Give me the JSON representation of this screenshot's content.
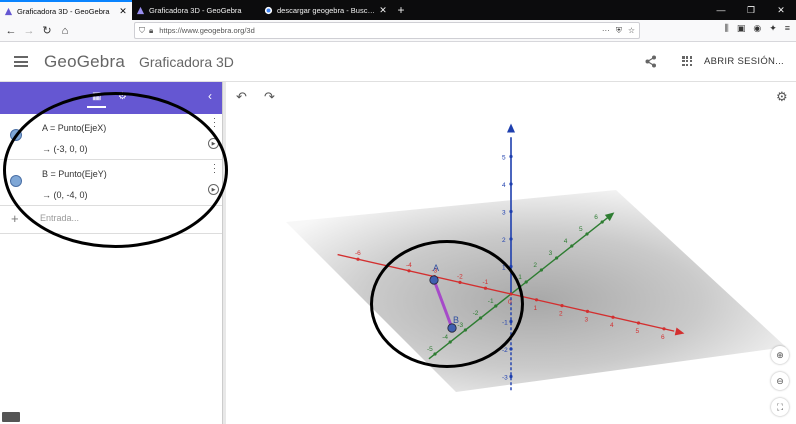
{
  "browser": {
    "tabs": [
      {
        "title": "Graficadora 3D - GeoGebra",
        "active": true
      },
      {
        "title": "Graficadora 3D - GeoGebra",
        "active": false
      },
      {
        "title": "descargar geogebra - Buscar c",
        "active": false
      }
    ],
    "url": "https://www.geogebra.org/3d"
  },
  "header": {
    "logo": "GeoGebra",
    "app_title": "Graficadora 3D",
    "signin_label": "ABRIR SESIÓN..."
  },
  "algebra": {
    "items": [
      {
        "definition": "A = Punto(EjeX)",
        "value": "→  (-3, 0, 0)",
        "color": "#7fa7d6"
      },
      {
        "definition": "B = Punto(EjeY)",
        "value": "→  (0, -4, 0)",
        "color": "#7fa7d6"
      }
    ],
    "input_placeholder": "Entrada..."
  },
  "graphics": {
    "x_axis_ticks": [
      "-6",
      "-4",
      "-3",
      "-2",
      "-1",
      "0",
      "1",
      "2",
      "3",
      "4",
      "5",
      "6"
    ],
    "y_axis_ticks": [
      "-5",
      "-4",
      "-3",
      "-2",
      "-1",
      "1",
      "2",
      "3",
      "4",
      "5",
      "6"
    ],
    "z_axis_ticks": [
      "5",
      "4",
      "3",
      "2",
      "1",
      "-1",
      "-2",
      "-3"
    ],
    "point_labels": [
      "A",
      "B"
    ],
    "colors": {
      "x_axis": "#d32f2f",
      "y_axis": "#2e7d32",
      "z_axis": "#1e3fae",
      "segment": "#a64ac9",
      "point": "#4060b0",
      "plane": "#bdbdbd",
      "accent": "#6557d2"
    }
  }
}
